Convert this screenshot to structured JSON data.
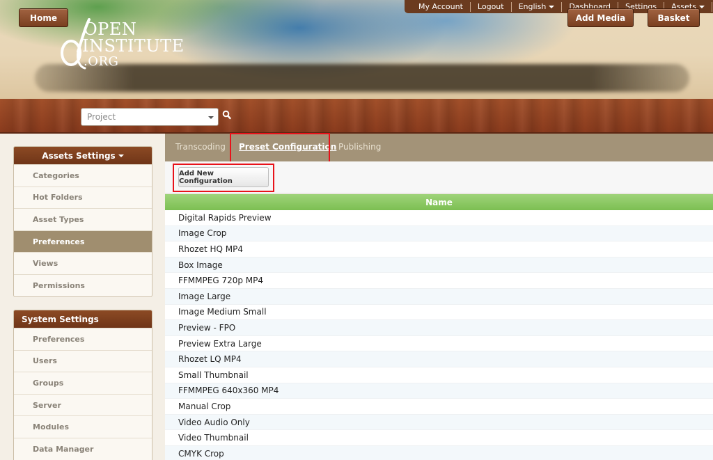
{
  "logo": {
    "line1": "OPEN",
    "line2": "INSTITUTE",
    "line3": ".ORG"
  },
  "topbar": {
    "my_account": "My Account",
    "logout": "Logout",
    "language": "English",
    "dashboard": "Dashboard",
    "settings": "Settings",
    "assets": "Assets"
  },
  "nav": {
    "home": "Home",
    "project_placeholder": "Project",
    "add_media": "Add Media",
    "basket": "Basket"
  },
  "sidebar": {
    "assets_settings": {
      "title": "Assets Settings",
      "items": [
        "Categories",
        "Hot Folders",
        "Asset Types",
        "Preferences",
        "Views",
        "Permissions"
      ],
      "active_index": 3
    },
    "system_settings": {
      "title": "System Settings",
      "items": [
        "Preferences",
        "Users",
        "Groups",
        "Server",
        "Modules",
        "Data Manager"
      ]
    }
  },
  "tabs": {
    "transcoding": "Transcoding",
    "preset_configuration": "Preset Configuration",
    "publishing": "Publishing",
    "active": "Preset Configuration"
  },
  "toolbar": {
    "add_new_configuration": "Add New Configuration"
  },
  "table": {
    "header": "Name",
    "rows": [
      "Digital Rapids Preview",
      "Image Crop",
      "Rhozet HQ MP4",
      "Box Image",
      "FFMMPEG 720p MP4",
      "Image Large",
      "Image Medium Small",
      "Preview - FPO",
      "Preview Extra Large",
      "Rhozet LQ MP4",
      "Small Thumbnail",
      "FFMMPEG 640x360 MP4",
      "Manual Crop",
      "Video Audio Only",
      "Video Thumbnail",
      "CMYK Crop"
    ]
  },
  "colors": {
    "nav_brown": "#8a3b1d",
    "sidebar_header": "#7a3d1c",
    "sidebar_active": "#a08e6f",
    "tabbar": "#a39378",
    "table_header_green": "#8cc963",
    "highlight_red": "#e8121a"
  }
}
